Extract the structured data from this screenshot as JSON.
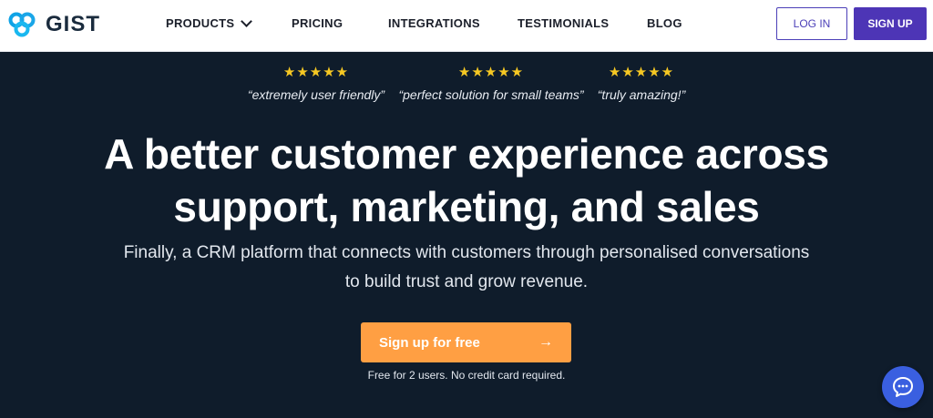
{
  "brand": {
    "name": "GIST"
  },
  "nav": {
    "products": "PRODUCTS",
    "pricing": "PRICING",
    "integrations": "INTEGRATIONS",
    "testimonials": "TESTIMONIALS",
    "blog": "BLOG"
  },
  "auth": {
    "login": "LOG IN",
    "signup": "SIGN UP"
  },
  "reviews": [
    {
      "stars": "★★★★★",
      "quote": "“extremely user friendly”"
    },
    {
      "stars": "★★★★★",
      "quote": "“perfect solution for small teams”"
    },
    {
      "stars": "★★★★★",
      "quote": "“truly amazing!”"
    }
  ],
  "hero": {
    "headline_line1": "A better customer experience across",
    "headline_line2": "support, marketing, and sales",
    "subline_line1": "Finally, a CRM platform that connects with customers through personalised conversations",
    "subline_line2": "to build trust and grow revenue.",
    "cta_label": "Sign up for free",
    "cta_arrow": "→",
    "note": "Free for 2 users. No credit card required."
  },
  "colors": {
    "background": "#0f1c2b",
    "accent": "#4d35b6",
    "cta": "#ff9f43",
    "stars": "#f6c823",
    "chat": "#3a5fe0"
  },
  "icons": [
    "gist-logo-icon",
    "chevron-down-icon",
    "star-icon",
    "arrow-right-icon",
    "chat-icon"
  ]
}
